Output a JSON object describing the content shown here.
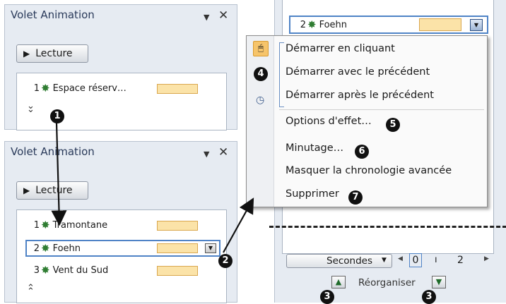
{
  "top_pane": {
    "title": "Volet Animation",
    "play_label": "Lecture",
    "items": [
      {
        "num": "1",
        "label": "Espace réserv…"
      }
    ]
  },
  "bottom_pane": {
    "title": "Volet Animation",
    "play_label": "Lecture",
    "items": [
      {
        "num": "1",
        "label": "Tramontane"
      },
      {
        "num": "2",
        "label": "Foehn"
      },
      {
        "num": "3",
        "label": "Vent du Sud"
      }
    ]
  },
  "right_panel": {
    "selected_item": {
      "num": "2",
      "label": "Foehn"
    },
    "menu": {
      "start_on_click": "Démarrer en cliquant",
      "start_with_previous": "Démarrer avec le précédent",
      "start_after_previous": "Démarrer après le précédent",
      "effect_options": "Options d'effet…",
      "timing": "Minutage…",
      "hide_timeline": "Masquer la chronologie avancée",
      "delete": "Supprimer"
    },
    "timeline": {
      "unit": "Secondes",
      "scale_start": "0",
      "scale_next": "2"
    },
    "reorder_label": "Réorganiser"
  },
  "callouts": [
    "1",
    "2",
    "3",
    "3",
    "4",
    "5",
    "6",
    "7"
  ],
  "colors": {
    "pane_bg": "#e6ebf2",
    "selection_border": "#4f83c6",
    "swatch": "#fbe3a8",
    "star": "#2f7d32"
  }
}
